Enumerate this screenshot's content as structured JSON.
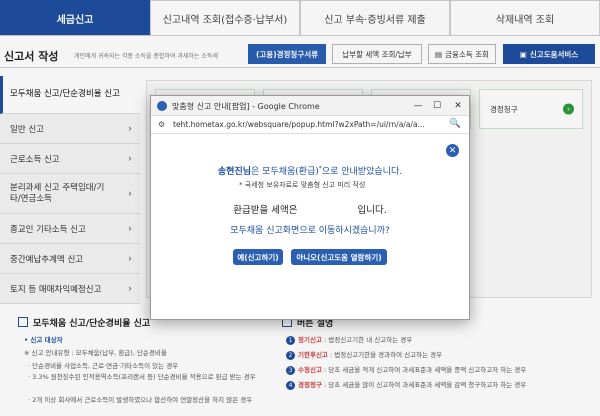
{
  "top_tabs": [
    "세금신고",
    "신고내역 조회(접수증·납부서)",
    "신고 부속·증빙서류 제출",
    "삭제내역 조회"
  ],
  "sub_bar": {
    "title": "신고서 작성",
    "desc": "개인에게 귀속되는 각종 소득을 종합하여 과세하는 소득세",
    "buttons": [
      "(고용)경정청구서류",
      "납부할 세액 조회/납부",
      "금융소득 조회",
      "신고도움서비스"
    ]
  },
  "left_menu": [
    {
      "label": "모두채움 신고/단순경비율 신고",
      "active": true
    },
    {
      "label": "일반 신고",
      "active": false
    },
    {
      "label": "근로소득 신고",
      "active": false
    },
    {
      "label": "분리과세 신고 주택임대/기타/연금소득",
      "active": false
    },
    {
      "label": "종교인 기타소득 신고",
      "active": false
    },
    {
      "label": "중간예납추계액 신고",
      "active": false
    },
    {
      "label": "토지 등 매매차익예정신고",
      "active": false
    }
  ],
  "bg_card_label": "경정청구",
  "bottom": {
    "left_title": "모두채움 신고/단순경비율 신고",
    "left_lines": [
      "• 신고 대상자",
      "※ 신고 안내유형 : 모두채움(납부, 환급), 단순경비율",
      "· 단순경비율 사업소득, 근로·연금·기타소득이 있는 경우",
      "· 3.3% 원천징수된 인적용역소득(프리랜서 등) 단순경비율 적용으로 환급 받는 경우",
      "· 2개 이상 회사에서 근로소득이 발생하였으나 합산하여 연말정산을 하지 않은 경우"
    ],
    "right_title": "버튼 설명",
    "right_lines": [
      {
        "num": "1",
        "key": "정기신고",
        "text": " : 법정신고기한 내 신고하는 경우"
      },
      {
        "num": "2",
        "key": "기한후신고",
        "text": " : 법정신고기한을 경과하여 신고하는 경우"
      },
      {
        "num": "3",
        "key": "수정신고",
        "text": " : 당초 세금을 적게 신고하여 과세표준과 세액을 증액 신고하고자 하는 경우"
      },
      {
        "num": "4",
        "key": "경정청구",
        "text": " : 당초 세금을 많이 신고하여 과세표준과 세액을 감액 청구하고자 하는 경우"
      }
    ]
  },
  "popup": {
    "window_title": "맞춤형 신고 안내[팝업] - Google Chrome",
    "url": "teht.hometax.go.kr/websquare/popup.html?w2xPath=/ui/rn/a/a/a...",
    "msg_name": "송현진님",
    "msg_rest": "은 모두채움(환급)",
    "msg_end": "으로 안내받았습니다.",
    "msg_sub": "* 국세청 보유자료로 맞춤형 신고 미리 작성",
    "amount_label": "환급받을 세액은",
    "amount_suffix": "입니다.",
    "question": "모두채움 신고화면으로 이동하시겠습니까?",
    "yes_button": "예(신고하기)",
    "no_button": "아니오(신고도움 열람하기)"
  }
}
